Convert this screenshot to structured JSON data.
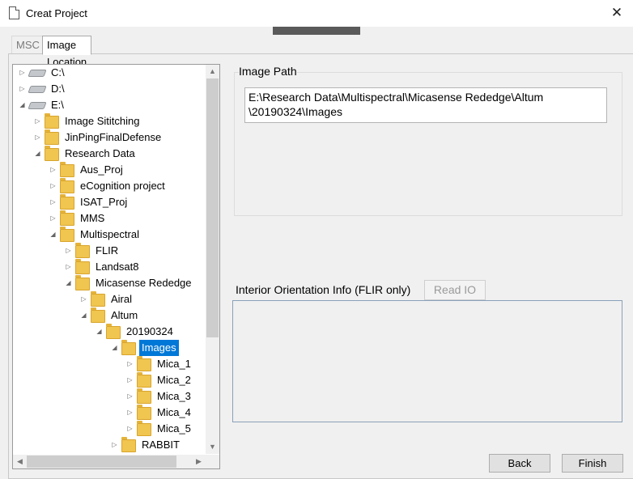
{
  "window": {
    "title": "Creat Project",
    "close_glyph": "✕"
  },
  "tabs": [
    {
      "label": "MSC"
    },
    {
      "label": "Image Location"
    }
  ],
  "tree": {
    "items": [
      {
        "label": "C:\\",
        "depth": 0,
        "type": "drive",
        "expander": "▷"
      },
      {
        "label": "D:\\",
        "depth": 0,
        "type": "drive",
        "expander": "▷"
      },
      {
        "label": "E:\\",
        "depth": 0,
        "type": "drive",
        "expander": "◢"
      },
      {
        "label": "Image Sititching",
        "depth": 1,
        "type": "folder",
        "expander": "▷"
      },
      {
        "label": "JinPingFinalDefense",
        "depth": 1,
        "type": "folder",
        "expander": "▷"
      },
      {
        "label": "Research Data",
        "depth": 1,
        "type": "folder",
        "expander": "◢"
      },
      {
        "label": "Aus_Proj",
        "depth": 2,
        "type": "folder",
        "expander": "▷"
      },
      {
        "label": "eCognition project",
        "depth": 2,
        "type": "folder",
        "expander": "▷"
      },
      {
        "label": "ISAT_Proj",
        "depth": 2,
        "type": "folder",
        "expander": "▷"
      },
      {
        "label": "MMS",
        "depth": 2,
        "type": "folder",
        "expander": "▷"
      },
      {
        "label": "Multispectral",
        "depth": 2,
        "type": "folder",
        "expander": "◢"
      },
      {
        "label": "FLIR",
        "depth": 3,
        "type": "folder",
        "expander": "▷"
      },
      {
        "label": "Landsat8",
        "depth": 3,
        "type": "folder",
        "expander": "▷"
      },
      {
        "label": "Micasense Rededge",
        "depth": 3,
        "type": "folder",
        "expander": "◢"
      },
      {
        "label": "Airal",
        "depth": 4,
        "type": "folder",
        "expander": "▷"
      },
      {
        "label": "Altum",
        "depth": 4,
        "type": "folder",
        "expander": "◢"
      },
      {
        "label": "20190324",
        "depth": 5,
        "type": "folder",
        "expander": "◢"
      },
      {
        "label": "Images",
        "depth": 6,
        "type": "folder",
        "expander": "◢",
        "selected": true
      },
      {
        "label": "Mica_1",
        "depth": 7,
        "type": "folder",
        "expander": "▷"
      },
      {
        "label": "Mica_2",
        "depth": 7,
        "type": "folder",
        "expander": "▷"
      },
      {
        "label": "Mica_3",
        "depth": 7,
        "type": "folder",
        "expander": "▷"
      },
      {
        "label": "Mica_4",
        "depth": 7,
        "type": "folder",
        "expander": "▷"
      },
      {
        "label": "Mica_5",
        "depth": 7,
        "type": "folder",
        "expander": "▷"
      },
      {
        "label": "RABBIT",
        "depth": 6,
        "type": "folder",
        "expander": "▷"
      }
    ]
  },
  "image_path": {
    "title": "Image Path",
    "value": "E:\\Research Data\\Multispectral\\Micasense Rededge\\Altum\n\\20190324\\Images"
  },
  "interior_orientation": {
    "label": "Interior Orientation Info (FLIR only)",
    "read_button": "Read IO"
  },
  "buttons": {
    "back": "Back",
    "finish": "Finish"
  },
  "colors": {
    "selection": "#0078d7",
    "folder": "#f0c550"
  }
}
